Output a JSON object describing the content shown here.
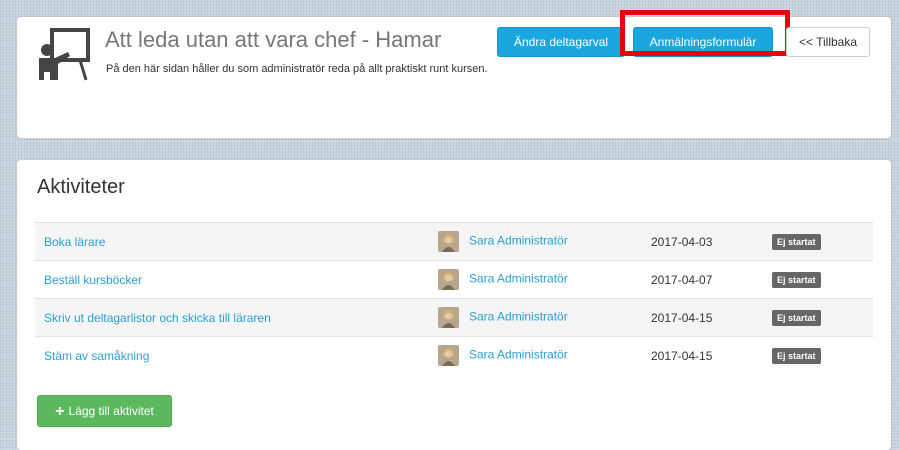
{
  "header": {
    "title": "Att leda utan att vara chef - Hamar",
    "subtitle": "På den här sidan håller du som administratör reda på allt praktiskt runt kursen.",
    "buttons": {
      "change": "Ändra deltagarval",
      "form": "Anmälningsformulär",
      "back": "<< Tillbaka"
    }
  },
  "activities": {
    "title": "Aktiviteter",
    "rows": [
      {
        "name": "Boka lärare",
        "user": "Sara Administratör",
        "date": "2017-04-03",
        "status": "Ej startat"
      },
      {
        "name": "Beställ kursböcker",
        "user": "Sara Administratör",
        "date": "2017-04-07",
        "status": "Ej startat"
      },
      {
        "name": "Skriv ut deltagarlistor och skicka till läraren",
        "user": "Sara Administratör",
        "date": "2017-04-15",
        "status": "Ej startat"
      },
      {
        "name": "Stäm av samåkning",
        "user": "Sara Administratör",
        "date": "2017-04-15",
        "status": "Ej startat"
      }
    ],
    "add_label": "Lägg till aktivitet"
  },
  "colors": {
    "primary": "#1aa6df",
    "success": "#5cb85c",
    "link": "#2a9fd6",
    "highlight": "#e8000f",
    "badge": "#666666"
  }
}
